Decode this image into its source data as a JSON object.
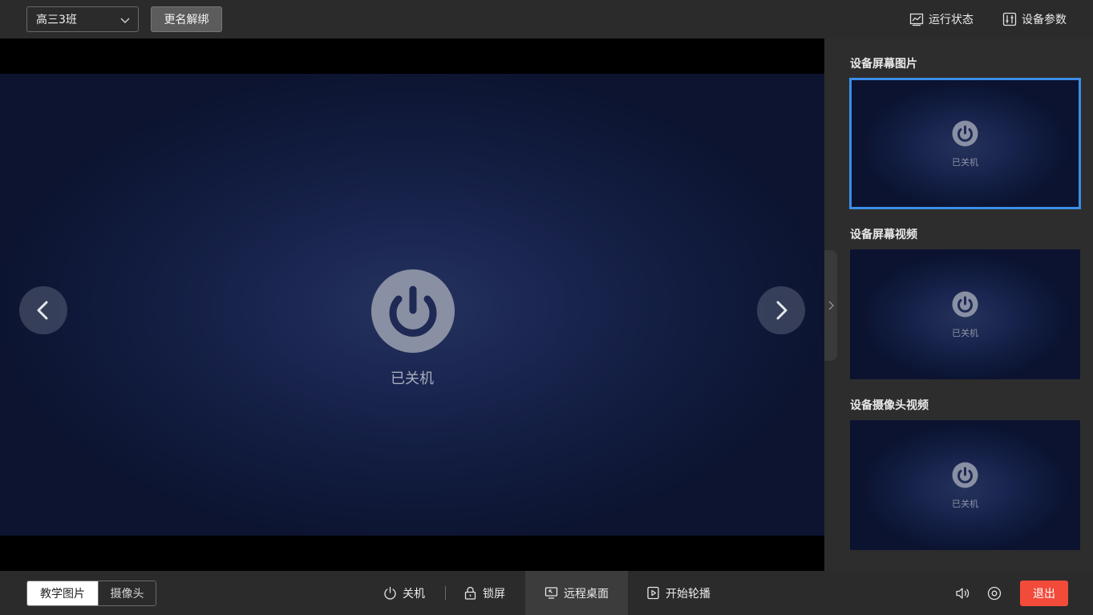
{
  "topbar": {
    "device_name": "高三3班",
    "rename_label": "更名解绑",
    "status_label": "运行状态",
    "params_label": "设备参数"
  },
  "viewer": {
    "status_text": "已关机"
  },
  "side": {
    "sections": [
      {
        "title": "设备屏幕图片",
        "status": "已关机",
        "selected": true
      },
      {
        "title": "设备屏幕视频",
        "status": "已关机",
        "selected": false
      },
      {
        "title": "设备摄像头视频",
        "status": "已关机",
        "selected": false
      }
    ]
  },
  "bottombar": {
    "tabs": [
      {
        "label": "教学图片",
        "active": true
      },
      {
        "label": "摄像头",
        "active": false
      }
    ],
    "tools": {
      "shutdown": "关机",
      "lock": "锁屏",
      "remote": "远程桌面",
      "carousel": "开始轮播"
    },
    "exit_label": "退出"
  },
  "icons": {
    "device_select": "chevron-down-icon",
    "status": "monitor-chart-icon",
    "params": "sliders-icon",
    "power": "power-icon",
    "prev": "chevron-left-icon",
    "next": "chevron-right-icon",
    "collapse": "chevron-right-icon",
    "shutdown": "power-icon",
    "lock": "lock-icon",
    "remote": "remote-desktop-icon",
    "carousel": "play-square-icon",
    "volume": "speaker-icon",
    "record": "record-icon"
  },
  "colors": {
    "accent": "#3a8ee8",
    "exit": "#f24b3a",
    "power_icon": "#8a90a3"
  }
}
